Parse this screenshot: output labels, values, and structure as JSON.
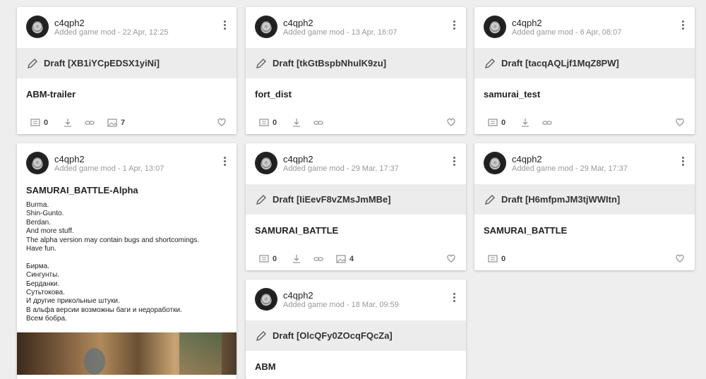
{
  "cards": [
    {
      "username": "c4qph2",
      "meta": "Added game mod - 22 Apr, 12:25",
      "draft": "Draft [XB1iYCpEDSX1yiNi]",
      "name": "ABM-trailer",
      "comments": "0",
      "images": "7"
    },
    {
      "username": "c4qph2",
      "meta": "Added game mod - 13 Apr, 16:07",
      "draft": "Draft [tkGtBspbNhulK9zu]",
      "name": "fort_dist",
      "comments": "0"
    },
    {
      "username": "c4qph2",
      "meta": "Added game mod - 6 Apr, 08:07",
      "draft": "Draft [tacqAQLjf1MqZ8PW]",
      "name": "samurai_test",
      "comments": "0"
    },
    {
      "username": "c4qph2",
      "meta": "Added game mod - 1 Apr, 13:07",
      "name": "SAMURAI_BATTLE-Alpha",
      "description": "Burma.\nShin-Gunto.\nBerdan.\nAnd more stuff.\nThe alpha version may contain bugs and shortcomings.\nHave fun.\n\nБирма.\nСингунты.\nБерданки.\nСутьтокова.\nИ другие прикольные штуки.\nВ альфа версии возможны баги и недоработки.\nВсем бобра."
    },
    {
      "username": "c4qph2",
      "meta": "Added game mod - 29 Mar, 17:37",
      "draft": "Draft [IiEevF8vZMsJmMBe]",
      "name": "SAMURAI_BATTLE",
      "comments": "0",
      "images": "4"
    },
    {
      "username": "c4qph2",
      "meta": "Added game mod - 29 Mar, 17:37",
      "draft": "Draft [H6mfpmJM3tjWWItn]",
      "name": "SAMURAI_BATTLE",
      "comments": "0"
    },
    {
      "username": "c4qph2",
      "meta": "Added game mod - 18 Mar, 09:59",
      "draft": "Draft [OlcQFy0ZOcqFQcZa]",
      "name": "ABM"
    }
  ]
}
